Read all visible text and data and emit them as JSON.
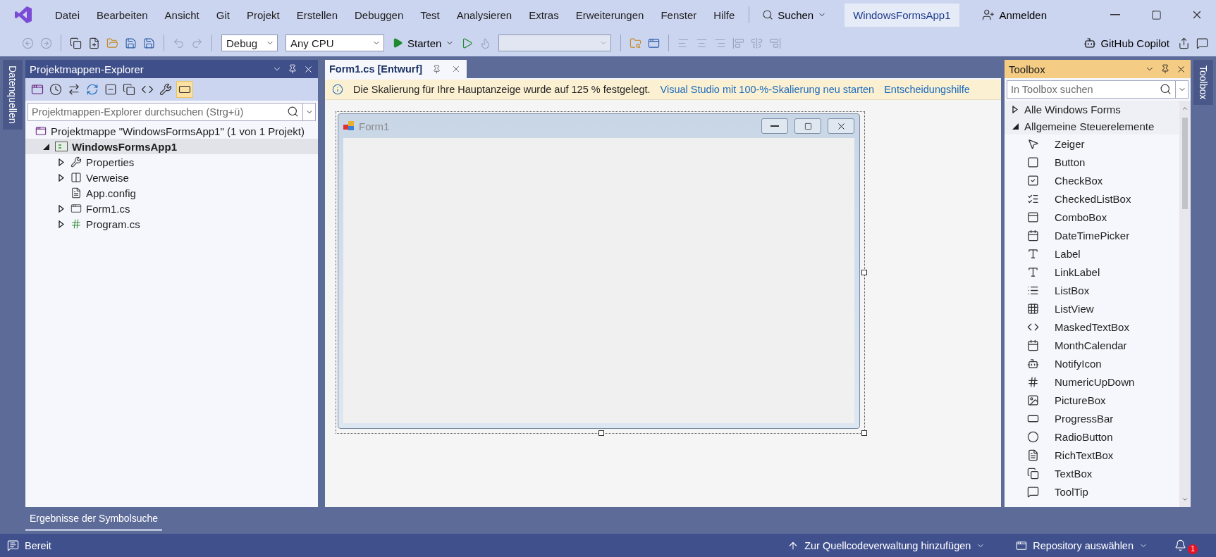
{
  "title_bar": {
    "menu": [
      "Datei",
      "Bearbeiten",
      "Ansicht",
      "Git",
      "Projekt",
      "Erstellen",
      "Debuggen",
      "Test",
      "Analysieren",
      "Extras",
      "Erweiterungen",
      "Fenster",
      "Hilfe"
    ],
    "search_label": "Suchen",
    "solution_name": "WindowsFormsApp1",
    "sign_in": "Anmelden"
  },
  "toolbar": {
    "configuration": "Debug",
    "platform": "Any CPU",
    "start": "Starten",
    "copilot": "GitHub Copilot"
  },
  "left_strip": {
    "tab": "Datenquellen"
  },
  "solution_explorer": {
    "title": "Projektmappen-Explorer",
    "search": {
      "placeholder": "Projektmappen-Explorer durchsuchen (Strg+ü)"
    },
    "tree": [
      {
        "label": "Projektmappe \"WindowsFormsApp1\" (1 von 1 Projekt)",
        "kind": "solution",
        "expandable": false,
        "selected": false,
        "children": [
          {
            "label": "WindowsFormsApp1",
            "kind": "project",
            "expandable": true,
            "expanded": true,
            "selected": true,
            "children": [
              {
                "label": "Properties",
                "kind": "properties",
                "expandable": true,
                "expanded": false,
                "selected": false
              },
              {
                "label": "Verweise",
                "kind": "references",
                "expandable": true,
                "expanded": false,
                "selected": false
              },
              {
                "label": "App.config",
                "kind": "config",
                "expandable": false,
                "selected": false
              },
              {
                "label": "Form1.cs",
                "kind": "form",
                "expandable": true,
                "expanded": false,
                "selected": false
              },
              {
                "label": "Program.cs",
                "kind": "csharp",
                "expandable": true,
                "expanded": false,
                "selected": false
              }
            ]
          }
        ]
      }
    ]
  },
  "editor": {
    "tabs": [
      {
        "label": "Form1.cs [Entwurf]",
        "selected": true
      }
    ],
    "infobar": {
      "message": "Die Skalierung für Ihre Hauptanzeige wurde auf 125 % festgelegt.",
      "links": [
        "Visual Studio mit 100-%-Skalierung neu starten",
        "Entscheidungshilfe"
      ]
    },
    "form": {
      "title": "Form1"
    }
  },
  "toolbox": {
    "title": "Toolbox",
    "search": {
      "placeholder": "In Toolbox suchen"
    },
    "groups": [
      {
        "label": "Alle Windows Forms",
        "expanded": false
      },
      {
        "label": "Allgemeine Steuerelemente",
        "expanded": true,
        "items": [
          {
            "label": "Zeiger",
            "kind": "pointer"
          },
          {
            "label": "Button",
            "kind": "button"
          },
          {
            "label": "CheckBox",
            "kind": "checkbox"
          },
          {
            "label": "CheckedListBox",
            "kind": "checkedlist"
          },
          {
            "label": "ComboBox",
            "kind": "combobox"
          },
          {
            "label": "DateTimePicker",
            "kind": "calendar"
          },
          {
            "label": "Label",
            "kind": "label"
          },
          {
            "label": "LinkLabel",
            "kind": "linklabel"
          },
          {
            "label": "ListBox",
            "kind": "listbox"
          },
          {
            "label": "ListView",
            "kind": "listview"
          },
          {
            "label": "MaskedTextBox",
            "kind": "masked"
          },
          {
            "label": "MonthCalendar",
            "kind": "calendar"
          },
          {
            "label": "NotifyIcon",
            "kind": "notify"
          },
          {
            "label": "NumericUpDown",
            "kind": "numeric"
          },
          {
            "label": "PictureBox",
            "kind": "picture"
          },
          {
            "label": "ProgressBar",
            "kind": "progress"
          },
          {
            "label": "RadioButton",
            "kind": "radio"
          },
          {
            "label": "RichTextBox",
            "kind": "richtext"
          },
          {
            "label": "TextBox",
            "kind": "textbox"
          },
          {
            "label": "ToolTip",
            "kind": "tooltip"
          }
        ]
      }
    ]
  },
  "right_strip": {
    "tab": "Toolbox"
  },
  "bottom_tabs": [
    "Ergebnisse der Symbolsuche"
  ],
  "status_bar": {
    "state": "Bereit",
    "source_control": "Zur Quellcodeverwaltung hinzufügen",
    "repository": "Repository auswählen",
    "notifications": "1"
  }
}
